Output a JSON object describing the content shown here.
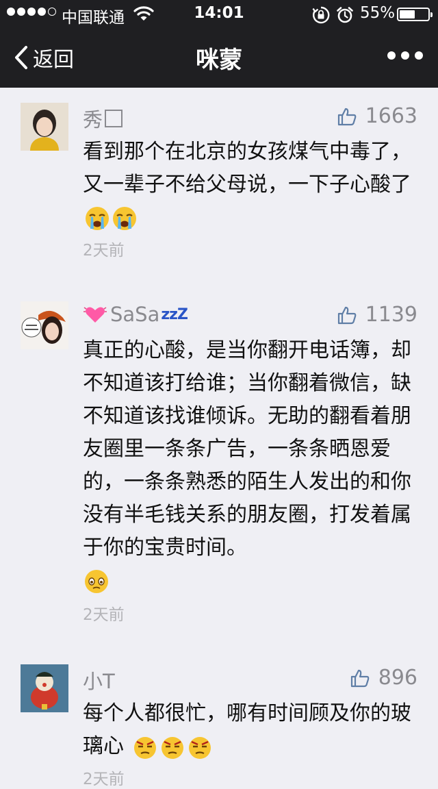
{
  "status_bar": {
    "carrier": "中国联通",
    "time": "14:01",
    "battery": "55%",
    "battery_level": 0.55,
    "icons": [
      "signal-dots",
      "wifi-icon",
      "rotation-lock-icon",
      "alarm-icon",
      "battery-icon"
    ]
  },
  "nav": {
    "back_label": "返回",
    "title": "咪蒙",
    "more_icon": "more-dots-icon"
  },
  "comments": [
    {
      "name": "秀",
      "name_suffix_icon": "missing-glyph-box",
      "likes": "1663",
      "text": "看到那个在北京的女孩煤气中毒了，又一辈子不给父母说，一下子心酸了",
      "emojis": [
        "crying-face",
        "crying-face"
      ],
      "time": "2天前"
    },
    {
      "name": "SaSa",
      "name_prefix_icon": "beating-heart-emoji",
      "name_suffix": "zzZ",
      "likes": "1139",
      "text": "真正的心酸，是当你翻开电话簿，却不知道该打给谁；当你翻着微信，缺不知道该找谁倾诉。无助的翻看着朋友圈里一条条广告，一条条晒恩爱的，一条条熟悉的陌生人发出的和你没有半毛钱关系的朋友圈，打发着属于你的宝贵时间。",
      "emojis": [
        "pleading-face"
      ],
      "time": "2天前"
    },
    {
      "name": "小T",
      "likes": "896",
      "text": "每个人都很忙，哪有时间顾及你的玻璃心",
      "emojis": [
        "annoyed-face",
        "annoyed-face",
        "annoyed-face"
      ],
      "time": "2天前"
    }
  ],
  "colors": {
    "header_bg": "#1f1f22",
    "page_bg": "#efeff4",
    "muted_text": "#8a8a8f",
    "time_text": "#b4b4b8"
  }
}
